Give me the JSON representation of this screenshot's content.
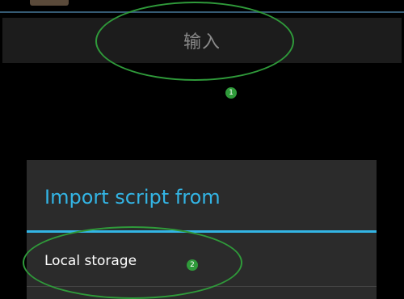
{
  "input": {
    "label": "输入"
  },
  "dialog": {
    "title": "Import script from",
    "items": [
      {
        "label": "Local storage"
      }
    ]
  },
  "annotations": [
    {
      "number": "1"
    },
    {
      "number": "2"
    }
  ],
  "colors": {
    "accent": "#33b5e5",
    "annotation": "#2f9a3a",
    "dialog_bg": "#2b2b2b"
  }
}
